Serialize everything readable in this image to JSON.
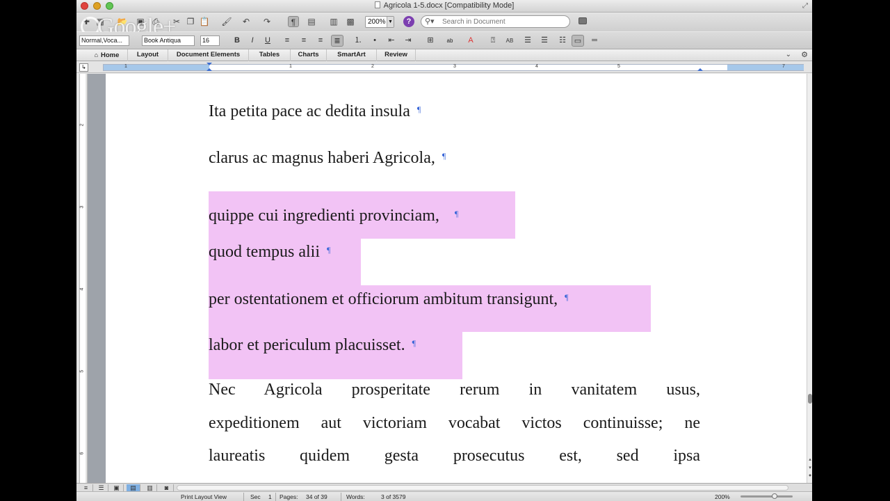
{
  "window": {
    "title": "Agricola 1-5.docx [Compatibility Mode]"
  },
  "overlay": {
    "text": "Google+"
  },
  "toolbar": {
    "zoom_value": "200%",
    "search_placeholder": "Search in Document"
  },
  "formatting": {
    "style_value": "Normal,Voca...",
    "font_value": "Book Antiqua",
    "size_value": "16",
    "bold_label": "B",
    "italic_label": "I",
    "underline_label": "U"
  },
  "ribbon": {
    "tabs": [
      {
        "label": "Home"
      },
      {
        "label": "Layout"
      },
      {
        "label": "Document Elements"
      },
      {
        "label": "Tables"
      },
      {
        "label": "Charts"
      },
      {
        "label": "SmartArt"
      },
      {
        "label": "Review"
      }
    ]
  },
  "ruler": {
    "numbers": [
      "1",
      "1",
      "1",
      "2",
      "3",
      "4",
      "5",
      "6",
      "7"
    ],
    "vertical_numbers": [
      "2",
      "3",
      "4",
      "5",
      "6"
    ]
  },
  "document": {
    "paragraphs": [
      {
        "text": "Ita petita pace ac dedita insula",
        "highlighted": false
      },
      {
        "text": "clarus ac magnus haberi Agricola,",
        "highlighted": false
      },
      {
        "text": "quippe cui ingredienti provinciam,",
        "highlighted": true
      },
      {
        "text": "quod tempus alii",
        "highlighted": true
      },
      {
        "text": "per ostentationem et officiorum ambitum transigunt,",
        "highlighted": true
      },
      {
        "text": "labor et periculum placuisset.",
        "highlighted": true
      }
    ],
    "pilcrow": "¶",
    "body_lines": [
      "Nec Agricola prosperitate rerum in vanitatem usus,",
      "expeditionem aut victoriam vocabat victos continuisse; ne",
      "laureatis quidem gesta prosecutus est, sed ipsa"
    ]
  },
  "status": {
    "view": "Print Layout View",
    "sec_label": "Sec",
    "sec_value": "1",
    "pages_label": "Pages:",
    "pages_value": "34 of 39",
    "words_label": "Words:",
    "words_value": "3 of 3579",
    "zoom": "200%"
  },
  "colors": {
    "highlight": "#f2c3f5",
    "pilcrow": "#3866d8",
    "active_view": "#7fb0e3"
  }
}
